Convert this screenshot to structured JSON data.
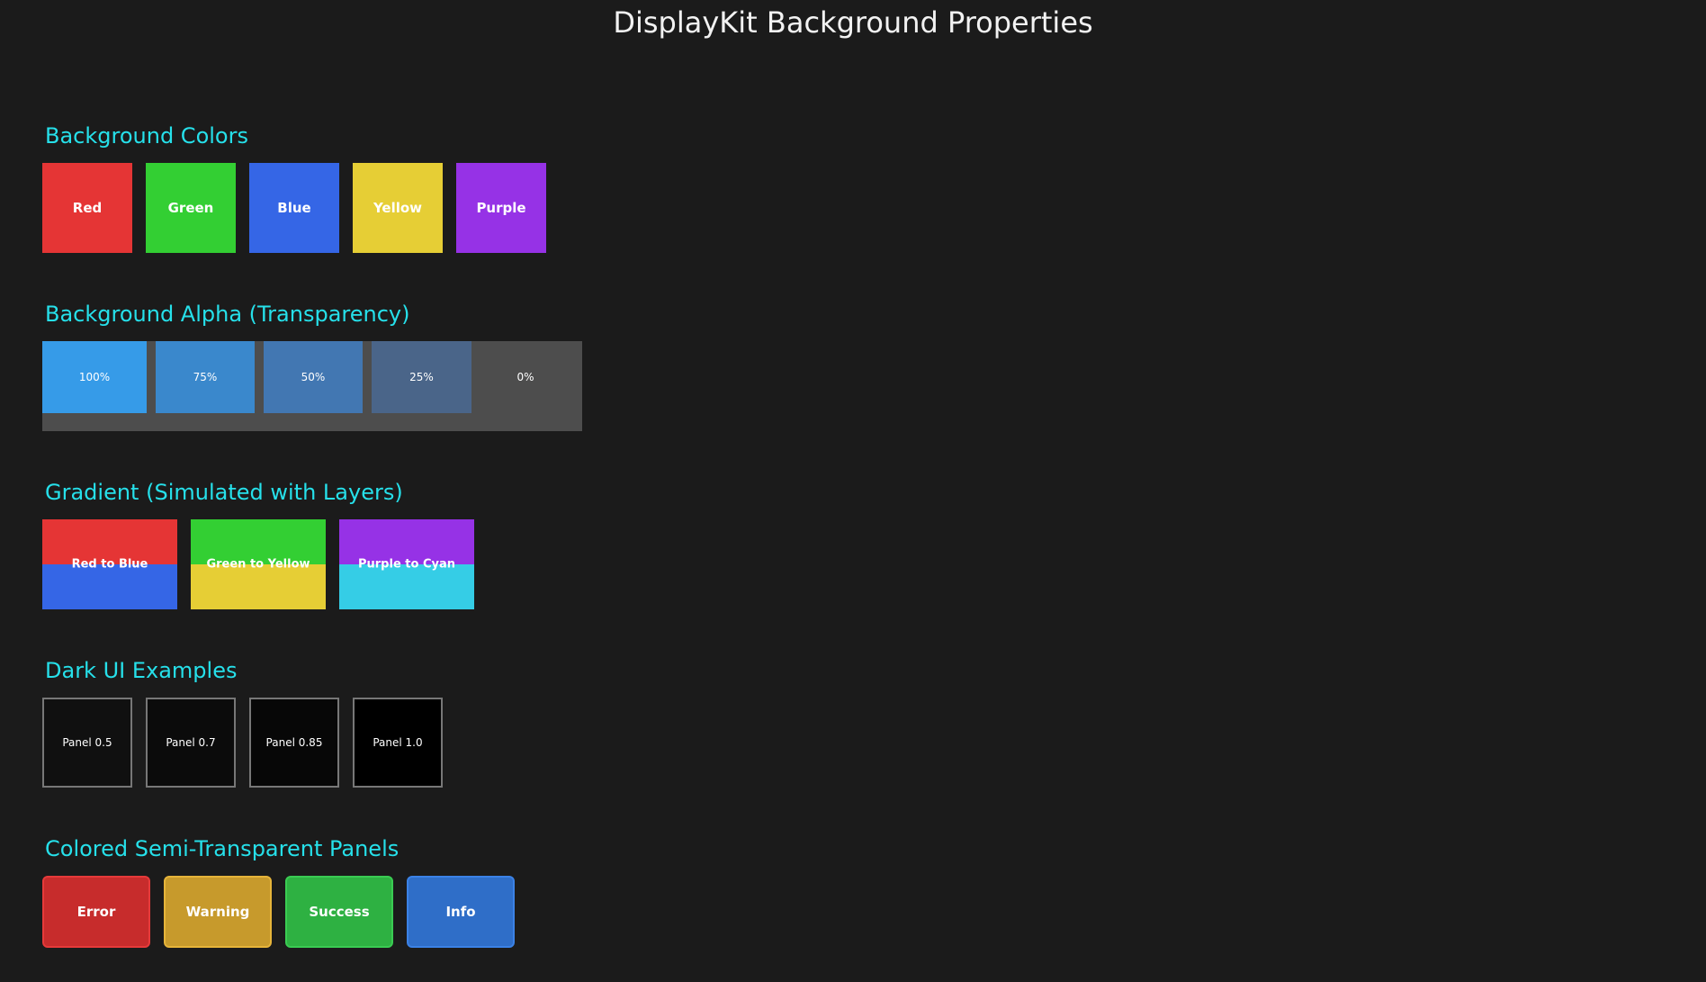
{
  "title": "DisplayKit Background Properties",
  "sections": {
    "colors": "Background Colors",
    "alpha": "Background Alpha (Transparency)",
    "gradient": "Gradient (Simulated with Layers)",
    "dark": "Dark UI Examples",
    "semi": "Colored Semi-Transparent Panels"
  },
  "colors": [
    {
      "label": "Red",
      "color": "#e53535"
    },
    {
      "label": "Green",
      "color": "#33cf33"
    },
    {
      "label": "Blue",
      "color": "#3566e6"
    },
    {
      "label": "Yellow",
      "color": "#e6ce35"
    },
    {
      "label": "Purple",
      "color": "#9632e6"
    }
  ],
  "alpha": [
    {
      "label": "100%",
      "color": "#369be8"
    },
    {
      "label": "75%",
      "color": "#3a88cc"
    },
    {
      "label": "50%",
      "color": "#4277b2"
    },
    {
      "label": "25%",
      "color": "#4a6589"
    },
    {
      "label": "0%",
      "color": "#4d4d4d"
    }
  ],
  "gradients": [
    {
      "label": "Red to Blue",
      "top": "#e53535",
      "bottom": "#3566e6"
    },
    {
      "label": "Green to Yellow",
      "top": "#33cf33",
      "bottom": "#e6ce35"
    },
    {
      "label": "Purple to Cyan",
      "top": "#9632e6",
      "bottom": "#35cde6"
    }
  ],
  "dark": [
    {
      "label": "Panel 0.5",
      "color": "#101010"
    },
    {
      "label": "Panel 0.7",
      "color": "#0b0b0b"
    },
    {
      "label": "Panel 0.85",
      "color": "#070707"
    },
    {
      "label": "Panel 1.0",
      "color": "#000000"
    }
  ],
  "semi": [
    {
      "label": "Error",
      "color": "#c72c2c",
      "border": "#e63a3a"
    },
    {
      "label": "Warning",
      "color": "#c79a2c",
      "border": "#e6b43a"
    },
    {
      "label": "Success",
      "color": "#2eb142",
      "border": "#3acc52"
    },
    {
      "label": "Info",
      "color": "#2f6ec8",
      "border": "#3b82e6"
    }
  ]
}
